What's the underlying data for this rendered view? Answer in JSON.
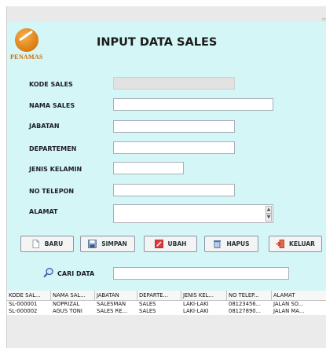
{
  "window": {
    "title_button": "▭"
  },
  "logo": {
    "text": "PENAMAS"
  },
  "title": "INPUT DATA SALES",
  "fields": {
    "kode_sales": {
      "label": "KODE SALES",
      "value": ""
    },
    "nama_sales": {
      "label": "NAMA SALES",
      "value": ""
    },
    "jabatan": {
      "label": "JABATAN",
      "value": ""
    },
    "departemen": {
      "label": "DEPARTEMEN",
      "value": ""
    },
    "jenis_kelamin": {
      "label": "JENIS KELAMIN",
      "value": ""
    },
    "no_telepon": {
      "label": "NO TELEPON",
      "value": ""
    },
    "alamat": {
      "label": "ALAMAT",
      "value": ""
    }
  },
  "buttons": {
    "baru": "BARU",
    "simpan": "SIMPAN",
    "ubah": "UBAH",
    "hapus": "HAPUS",
    "keluar": "KELUAR"
  },
  "search": {
    "label": "CARI DATA",
    "value": ""
  },
  "table": {
    "columns": [
      "KODE SAL...",
      "NAMA SAL...",
      "JABATAN",
      "DEPARTE...",
      "JENIS KEL...",
      "NO TELEP...",
      "ALAMAT"
    ],
    "rows": [
      [
        "SL-000001",
        "NOPRIZAL",
        "SALESMAN",
        "SALES",
        "LAKI-LAKI",
        "08123456...",
        "JALAN SO..."
      ],
      [
        "SL-000002",
        "AGUS TONI",
        "SALES RE...",
        "SALES",
        "LAKI-LAKI",
        "08127890...",
        "JALAN MA..."
      ]
    ]
  },
  "colors": {
    "form_background": "#d5f6f6",
    "logo_orange": "#d97c12",
    "delete_icon_red": "#cc2222",
    "exit_icon_red": "#d23a2a"
  },
  "icons": {
    "baru": "new-document-icon",
    "simpan": "save-icon",
    "ubah": "edit-icon",
    "hapus": "delete-icon",
    "keluar": "exit-icon",
    "search": "search-icon"
  }
}
